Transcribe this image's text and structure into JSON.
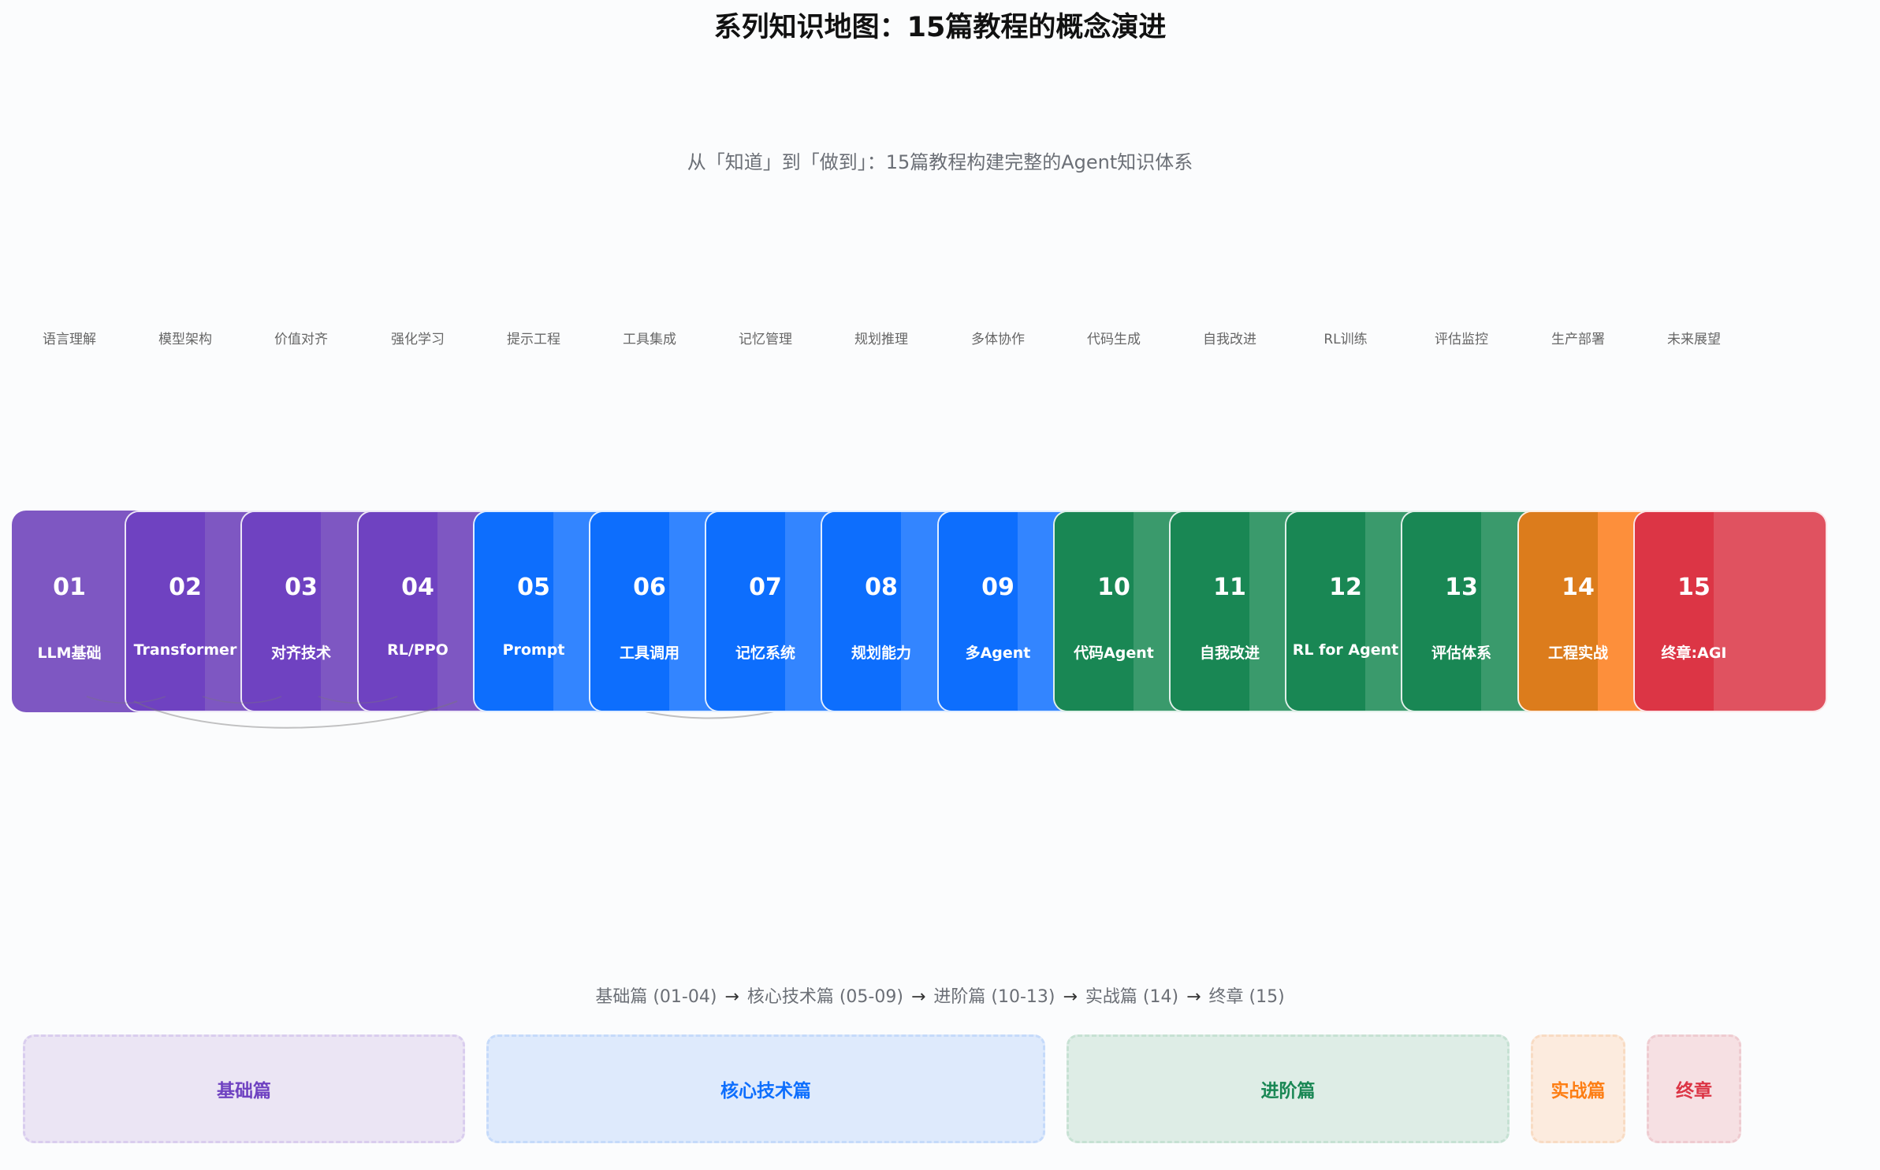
{
  "title": "系列知识地图：15篇教程的概念演进",
  "subtitle": "从「知道」到「做到」：15篇教程构建完整的Agent知识体系",
  "steps": [
    {
      "num": "01",
      "label": "LLM基础",
      "concept": "语言理解",
      "group": "basic"
    },
    {
      "num": "02",
      "label": "Transformer",
      "concept": "模型架构",
      "group": "basic"
    },
    {
      "num": "03",
      "label": "对齐技术",
      "concept": "价值对齐",
      "group": "basic"
    },
    {
      "num": "04",
      "label": "RL/PPO",
      "concept": "强化学习",
      "group": "basic"
    },
    {
      "num": "05",
      "label": "Prompt",
      "concept": "提示工程",
      "group": "core"
    },
    {
      "num": "06",
      "label": "工具调用",
      "concept": "工具集成",
      "group": "core"
    },
    {
      "num": "07",
      "label": "记忆系统",
      "concept": "记忆管理",
      "group": "core"
    },
    {
      "num": "08",
      "label": "规划能力",
      "concept": "规划推理",
      "group": "core"
    },
    {
      "num": "09",
      "label": "多Agent",
      "concept": "多体协作",
      "group": "core"
    },
    {
      "num": "10",
      "label": "代码Agent",
      "concept": "代码生成",
      "group": "advanced"
    },
    {
      "num": "11",
      "label": "自我改进",
      "concept": "自我改进",
      "group": "advanced"
    },
    {
      "num": "12",
      "label": "RL for Agent",
      "concept": "RL训练",
      "group": "advanced"
    },
    {
      "num": "13",
      "label": "评估体系",
      "concept": "评估监控",
      "group": "advanced"
    },
    {
      "num": "14",
      "label": "工程实战",
      "concept": "生产部署",
      "group": "practice"
    },
    {
      "num": "15",
      "label": "终章:AGI",
      "concept": "未来展望",
      "group": "final"
    }
  ],
  "flow": [
    "基础篇 (01-04)",
    "核心技术篇 (05-09)",
    "进阶篇 (10-13)",
    "实战篇 (14)",
    "终章 (15)"
  ],
  "flow_arrow": "→",
  "groups": {
    "basic": {
      "label": "基础篇",
      "color": "#7e57c2",
      "shade": "#6f42c1",
      "bg": "#ebe5f4",
      "border": "#d9cdee",
      "text": "#6f42c1"
    },
    "core": {
      "label": "核心技术篇",
      "color": "#3385ff",
      "shade": "#0d6efd",
      "bg": "#deeafc",
      "border": "#c5dafa",
      "text": "#0d6efd"
    },
    "advanced": {
      "label": "进阶篇",
      "color": "#3a9a6c",
      "shade": "#198754",
      "bg": "#deede6",
      "border": "#c6e1d3",
      "text": "#198754"
    },
    "practice": {
      "label": "实战篇",
      "color": "#fd8f3b",
      "shade": "#dc7c1c",
      "bg": "#fcebde",
      "border": "#f8dbc3",
      "text": "#fd7e14"
    },
    "final": {
      "label": "终章",
      "color": "#e05260",
      "shade": "#dc3545",
      "bg": "#f6e0e3",
      "border": "#eecbd0",
      "text": "#dc3545"
    }
  }
}
